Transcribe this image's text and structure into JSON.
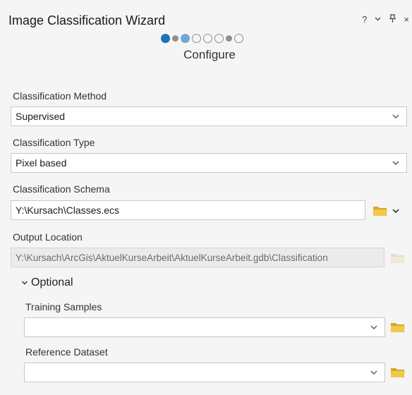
{
  "header": {
    "title": "Image Classification Wizard",
    "controls": {
      "help": "?",
      "dropdown": "⌄",
      "pin": "ᛘ",
      "close": "×"
    },
    "step_name": "Configure"
  },
  "fields": {
    "classification_method": {
      "label": "Classification Method",
      "value": "Supervised"
    },
    "classification_type": {
      "label": "Classification Type",
      "value": "Pixel based"
    },
    "classification_schema": {
      "label": "Classification Schema",
      "value": "Y:\\Kursach\\Classes.ecs"
    },
    "output_location": {
      "label": "Output Location",
      "value": "Y:\\Kursach\\ArcGis\\AktuelKurseArbeit\\AktuelKurseArbeit.gdb\\Classification"
    }
  },
  "optional": {
    "label": "Optional",
    "training_samples": {
      "label": "Training Samples",
      "value": ""
    },
    "reference_dataset": {
      "label": "Reference Dataset",
      "value": ""
    }
  },
  "colors": {
    "accent": "#1f72b8",
    "folder": "#e3b32d"
  },
  "icons": [
    "help-icon",
    "chevron-down-icon",
    "pin-icon",
    "close-icon",
    "folder-icon"
  ]
}
